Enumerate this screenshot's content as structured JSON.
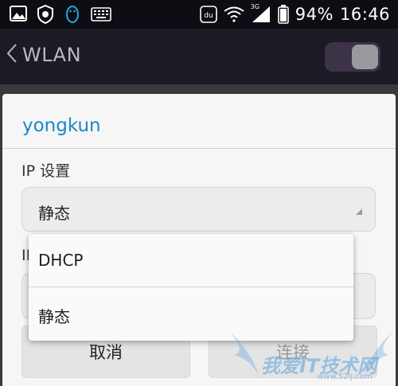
{
  "status_bar": {
    "battery": "94%",
    "time": "16:46",
    "network_small": "3G"
  },
  "header": {
    "title": "WLAN"
  },
  "dialog": {
    "network_name": "yongkun",
    "ip_settings_label": "IP 设置",
    "ip_settings_value": "静态",
    "second_label_fragment": "IP",
    "cancel_label": "取消",
    "connect_label": "连接"
  },
  "dropdown": {
    "options": [
      {
        "label": "DHCP"
      },
      {
        "label": "静态"
      }
    ]
  },
  "watermark": {
    "text": "我爱IT技术网",
    "url": "www.52ij.com"
  },
  "colors": {
    "accent": "#1b87c8",
    "toggle_track": "#3c3346",
    "app_bar": "#1b1a25"
  }
}
